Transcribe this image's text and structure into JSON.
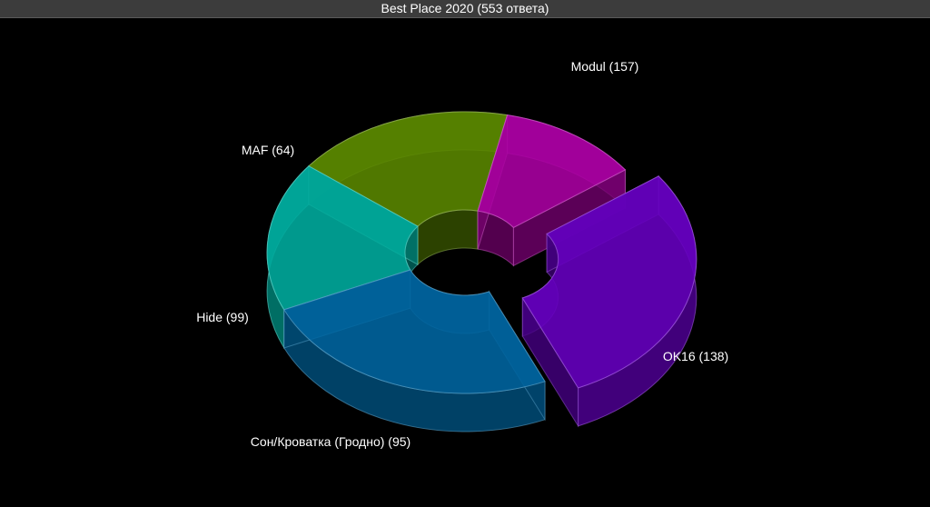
{
  "window": {
    "title": "Best Place 2020 (553 ответа)"
  },
  "chart_data": {
    "type": "pie",
    "variant": "donut-3d",
    "title": "Best Place 2020 (553 ответа)",
    "total": 553,
    "exploded_slice": "Modul",
    "slices": [
      {
        "label": "Modul",
        "value": 157,
        "display": "Modul (157)",
        "color": "#6a00c8"
      },
      {
        "label": "OK16",
        "value": 138,
        "display": "OK16 (138)",
        "color": "#0069a6"
      },
      {
        "label": "Сон/Кроватка (Гродно)",
        "value": 95,
        "display": "Сон/Кроватка (Гродно) (95)",
        "color": "#00b3a4"
      },
      {
        "label": "Hide",
        "value": 99,
        "display": "Hide (99)",
        "color": "#5e8c00"
      },
      {
        "label": "MAF",
        "value": 64,
        "display": "MAF (64)",
        "color": "#b000a8"
      }
    ],
    "legend": "none",
    "background": "#000000"
  }
}
